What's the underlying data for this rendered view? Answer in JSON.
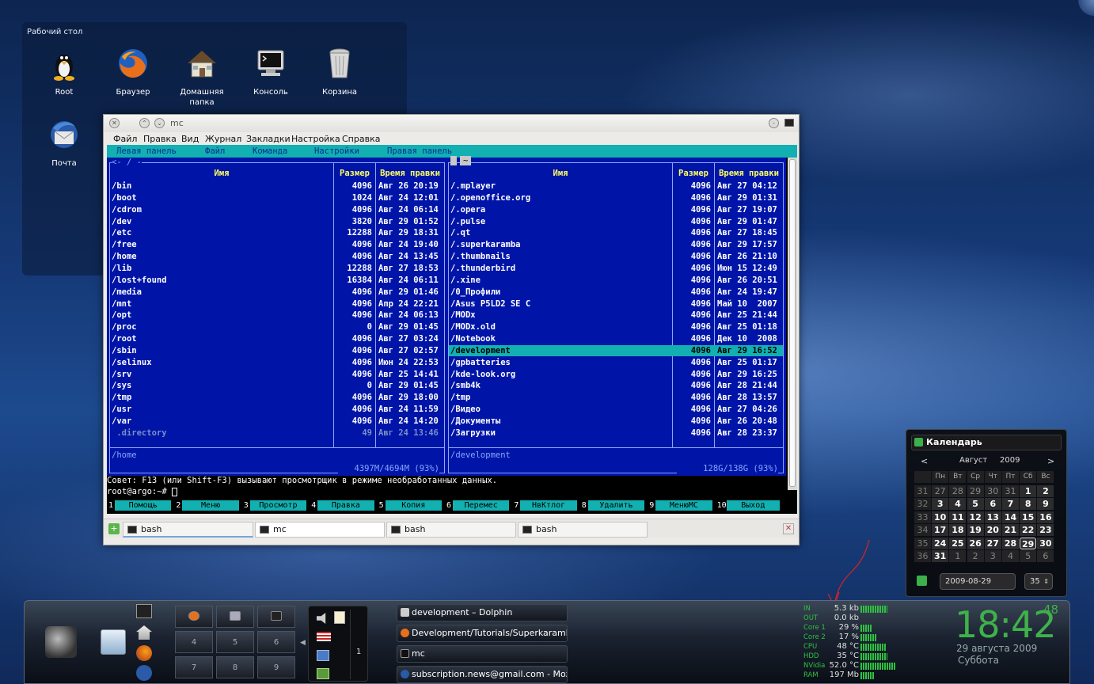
{
  "desktop": {
    "folder_title": "Рабочий стол",
    "icons": [
      {
        "label": "Root",
        "icon": "tux-icon"
      },
      {
        "label": "Браузер",
        "icon": "firefox-icon"
      },
      {
        "label": "Домашняя папка",
        "icon": "home-folder-icon"
      },
      {
        "label": "Консоль",
        "icon": "terminal-icon"
      },
      {
        "label": "Корзина",
        "icon": "trash-icon"
      },
      {
        "label": "Почта",
        "icon": "thunderbird-icon"
      }
    ]
  },
  "window": {
    "title": "mc",
    "menu": [
      "Файл",
      "Правка",
      "Вид",
      "Журнал",
      "Закладки",
      "Настройка",
      "Справка"
    ],
    "mc_menu": [
      "Левая панель",
      "Файл",
      "Команда",
      "Настройки",
      "Правая панель"
    ],
    "left": {
      "path_top": "<- / -",
      "cols": [
        "Имя",
        "Размер",
        "Время правки"
      ],
      "rows": [
        [
          "/bin",
          "4096",
          "Авг 26 20:19"
        ],
        [
          "/boot",
          "1024",
          "Авг 24 12:01"
        ],
        [
          "/cdrom",
          "4096",
          "Авг 24 06:14"
        ],
        [
          "/dev",
          "3820",
          "Авг 29 01:52"
        ],
        [
          "/etc",
          "12288",
          "Авг 29 18:31"
        ],
        [
          "/free",
          "4096",
          "Авг 24 19:40"
        ],
        [
          "/home",
          "4096",
          "Авг 24 13:45"
        ],
        [
          "/lib",
          "12288",
          "Авг 27 18:53"
        ],
        [
          "/lost+found",
          "16384",
          "Авг 24 06:11"
        ],
        [
          "/media",
          "4096",
          "Авг 29 01:46"
        ],
        [
          "/mnt",
          "4096",
          "Апр 24 22:21"
        ],
        [
          "/opt",
          "4096",
          "Авг 24 06:13"
        ],
        [
          "/proc",
          "0",
          "Авг 29 01:45"
        ],
        [
          "/root",
          "4096",
          "Авг 27 03:24"
        ],
        [
          "/sbin",
          "4096",
          "Авг 27 02:57"
        ],
        [
          "/selinux",
          "4096",
          "Июн 24 22:53"
        ],
        [
          "/srv",
          "4096",
          "Авг 25 14:41"
        ],
        [
          "/sys",
          "0",
          "Авг 29 01:45"
        ],
        [
          "/tmp",
          "4096",
          "Авг 29 18:00"
        ],
        [
          "/usr",
          "4096",
          "Авг 24 11:59"
        ],
        [
          "/var",
          "4096",
          "Авг 24 14:20"
        ],
        [
          " .directory",
          "49",
          "Авг 24 13:46"
        ]
      ],
      "status": "/home",
      "space": "4397M/4694M (93%)"
    },
    "right": {
      "path_top": "~",
      "cols": [
        "Имя",
        "Размер",
        "Время правки"
      ],
      "rows": [
        [
          "/.mplayer",
          "4096",
          "Авг 27 04:12"
        ],
        [
          "/.openoffice.org",
          "4096",
          "Авг 29 01:31"
        ],
        [
          "/.opera",
          "4096",
          "Авг 27 19:07"
        ],
        [
          "/.pulse",
          "4096",
          "Авг 29 01:47"
        ],
        [
          "/.qt",
          "4096",
          "Авг 27 18:45"
        ],
        [
          "/.superkaramba",
          "4096",
          "Авг 29 17:57"
        ],
        [
          "/.thumbnails",
          "4096",
          "Авг 26 21:10"
        ],
        [
          "/.thunderbird",
          "4096",
          "Июн 15 12:49"
        ],
        [
          "/.xine",
          "4096",
          "Авг 26 20:51"
        ],
        [
          "/0_Профили",
          "4096",
          "Авг 24 19:47"
        ],
        [
          "/Asus P5LD2 SE C",
          "4096",
          "Май 10  2007"
        ],
        [
          "/MODx",
          "4096",
          "Авг 25 21:44"
        ],
        [
          "/MODx.old",
          "4096",
          "Авг 25 01:18"
        ],
        [
          "/Notebook",
          "4096",
          "Дек 10  2008"
        ],
        [
          "/development",
          "4096",
          "Авг 29 16:52"
        ],
        [
          "/gpbatteries",
          "4096",
          "Авг 25 01:17"
        ],
        [
          "/kde-look.org",
          "4096",
          "Авг 29 16:25"
        ],
        [
          "/smb4k",
          "4096",
          "Авг 28 21:44"
        ],
        [
          "/tmp",
          "4096",
          "Авг 28 13:57"
        ],
        [
          "/Видео",
          "4096",
          "Авг 27 04:26"
        ],
        [
          "/Документы",
          "4096",
          "Авг 26 20:48"
        ],
        [
          "/Загрузки",
          "4096",
          "Авг 28 23:37"
        ]
      ],
      "selected_index": 14,
      "status": "/development",
      "space": "128G/138G (93%)"
    },
    "hint": "Совет: F13 (или Shift-F3) вызывают просмотрщик в режиме необработанных данных.",
    "prompt": "root@argo:~# ",
    "fkeys": [
      {
        "n": "1",
        "label": "Помощь"
      },
      {
        "n": "2",
        "label": "Меню"
      },
      {
        "n": "3",
        "label": "Просмотр"
      },
      {
        "n": "4",
        "label": "Правка"
      },
      {
        "n": "5",
        "label": "Копия"
      },
      {
        "n": "6",
        "label": "Перемес"
      },
      {
        "n": "7",
        "label": "НвКтлог"
      },
      {
        "n": "8",
        "label": "Удалить"
      },
      {
        "n": "9",
        "label": "МенюМС"
      },
      {
        "n": "10",
        "label": "Выход"
      }
    ],
    "tabs": [
      "bash",
      "mc",
      "bash",
      "bash"
    ],
    "active_tab": 1
  },
  "calendar": {
    "title": "Календарь",
    "month": "Август",
    "year": "2009",
    "weekdays": [
      "Пн",
      "Вт",
      "Ср",
      "Чт",
      "Пт",
      "Сб",
      "Вс"
    ],
    "weeks": [
      {
        "wk": "31",
        "days": [
          "27",
          "28",
          "29",
          "30",
          "31",
          "1",
          "2"
        ]
      },
      {
        "wk": "32",
        "days": [
          "3",
          "4",
          "5",
          "6",
          "7",
          "8",
          "9"
        ]
      },
      {
        "wk": "33",
        "days": [
          "10",
          "11",
          "12",
          "13",
          "14",
          "15",
          "16"
        ]
      },
      {
        "wk": "34",
        "days": [
          "17",
          "18",
          "19",
          "20",
          "21",
          "22",
          "23"
        ]
      },
      {
        "wk": "35",
        "days": [
          "24",
          "25",
          "26",
          "27",
          "28",
          "29",
          "30"
        ]
      },
      {
        "wk": "36",
        "days": [
          "31",
          "1",
          "2",
          "3",
          "4",
          "5",
          "6"
        ]
      }
    ],
    "date_field": "2009-08-29",
    "week_field": "35"
  },
  "taskbar": {
    "pager": [
      "",
      "",
      "",
      "4",
      "5",
      "6",
      "7",
      "8",
      "9"
    ],
    "tray_num": "1",
    "tasks": [
      "development – Dolphin",
      "Development/Tutorials/Superkaramba -",
      "mc",
      "subscription.news@gmail.com - Mozilla"
    ],
    "sys": [
      {
        "label": "IN",
        "value": "5.3 kb"
      },
      {
        "label": "OUT",
        "value": "0.0 kb"
      },
      {
        "label": "Core 1",
        "value": "29 %"
      },
      {
        "label": "Core 2",
        "value": "17 %"
      },
      {
        "label": "CPU",
        "value": "48 °C"
      },
      {
        "label": "HDD",
        "value": "35 °C"
      },
      {
        "label": "NVidia",
        "value": "52.0 °C"
      },
      {
        "label": "RAM",
        "value": "197 Mb"
      }
    ],
    "clock": "18:42",
    "seconds": "48",
    "date": "29 августа 2009",
    "weekday": "Суббота"
  },
  "colors": {
    "mc_blue": "#0015a8",
    "mc_cyan": "#12b0b0",
    "clock_green": "#3fb14a",
    "meter_green": "#2fc040"
  }
}
